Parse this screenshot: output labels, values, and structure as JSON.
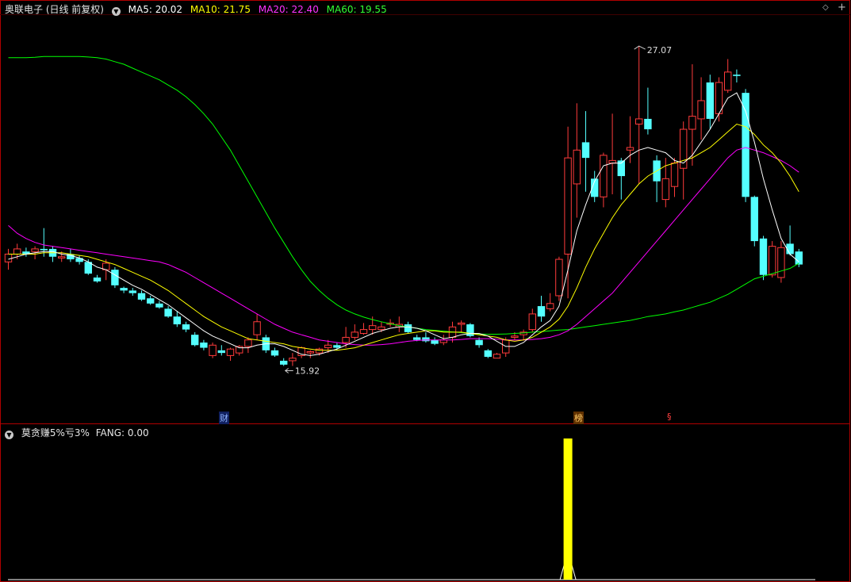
{
  "main": {
    "title": "奥联电子 (日线 前复权)",
    "ma5": "MA5: 20.02",
    "ma10": "MA10: 21.75",
    "ma20": "MA20: 22.40",
    "ma60": "MA60: 19.55",
    "high_label": "27.07",
    "low_label": "15.92",
    "markers": [
      "财",
      "榜",
      "§"
    ]
  },
  "sub": {
    "title": "莫贪赚5%亏3%",
    "value": "FANG: 0.00"
  },
  "colors": {
    "up": "#ff3b3b",
    "down": "#54ffff",
    "ma5": "#ffffff",
    "ma10": "#ffff00",
    "ma20": "#ff00ff",
    "ma60": "#00ff00",
    "signal": "#ffff00",
    "frame": "#b00000"
  },
  "icons": {
    "collapse": "chevron-down-icon",
    "diamond": "diamond-icon",
    "plus": "plus-icon"
  },
  "chart_data": [
    {
      "type": "candlestick",
      "title": "奥联电子 (日线 前复权)",
      "ylim": [
        14.0,
        29.0
      ],
      "ohlc": [
        [
          19.6,
          20.1,
          19.3,
          19.9
        ],
        [
          19.9,
          20.3,
          19.7,
          20.1
        ],
        [
          20.0,
          20.15,
          19.8,
          19.9
        ],
        [
          20.0,
          20.2,
          19.7,
          20.1
        ],
        [
          20.1,
          20.9,
          19.8,
          20.05
        ],
        [
          20.1,
          20.2,
          19.6,
          19.8
        ],
        [
          19.75,
          20.0,
          19.6,
          19.8
        ],
        [
          19.9,
          20.1,
          19.6,
          19.7
        ],
        [
          19.75,
          19.85,
          19.5,
          19.6
        ],
        [
          19.6,
          19.7,
          19.1,
          19.15
        ],
        [
          19.0,
          19.1,
          18.8,
          18.85
        ],
        [
          19.3,
          19.7,
          18.9,
          19.55
        ],
        [
          19.3,
          19.4,
          18.6,
          18.7
        ],
        [
          18.6,
          18.65,
          18.4,
          18.5
        ],
        [
          18.5,
          18.6,
          18.3,
          18.4
        ],
        [
          18.4,
          18.5,
          18.1,
          18.15
        ],
        [
          18.2,
          18.3,
          17.95,
          18.0
        ],
        [
          18.0,
          18.1,
          17.8,
          17.85
        ],
        [
          17.8,
          17.9,
          17.45,
          17.5
        ],
        [
          17.5,
          17.7,
          17.1,
          17.2
        ],
        [
          17.2,
          17.3,
          16.9,
          17.0
        ],
        [
          16.8,
          16.9,
          16.35,
          16.4
        ],
        [
          16.5,
          16.6,
          16.2,
          16.3
        ],
        [
          16.0,
          16.5,
          15.9,
          16.4
        ],
        [
          16.2,
          16.4,
          16.0,
          16.1
        ],
        [
          16.0,
          16.3,
          15.8,
          16.25
        ],
        [
          16.1,
          16.4,
          16.0,
          16.35
        ],
        [
          16.35,
          16.7,
          16.1,
          16.6
        ],
        [
          16.8,
          17.6,
          16.6,
          17.3
        ],
        [
          16.7,
          16.8,
          16.1,
          16.2
        ],
        [
          16.2,
          16.3,
          15.95,
          16.0
        ],
        [
          15.8,
          15.9,
          15.6,
          15.65
        ],
        [
          15.8,
          16.1,
          15.6,
          15.9
        ],
        [
          16.0,
          16.35,
          15.9,
          16.3
        ],
        [
          16.1,
          16.2,
          15.9,
          16.15
        ],
        [
          16.1,
          16.3,
          16.0,
          16.25
        ],
        [
          16.3,
          16.6,
          16.1,
          16.4
        ],
        [
          16.4,
          16.5,
          16.2,
          16.3
        ],
        [
          16.5,
          17.1,
          16.3,
          16.7
        ],
        [
          16.7,
          17.2,
          16.6,
          16.9
        ],
        [
          16.85,
          17.25,
          16.8,
          17.0
        ],
        [
          17.0,
          17.5,
          16.8,
          17.15
        ],
        [
          17.0,
          17.3,
          16.9,
          17.1
        ],
        [
          17.2,
          17.4,
          17.1,
          17.25
        ],
        [
          17.1,
          17.5,
          16.9,
          17.2
        ],
        [
          17.2,
          17.3,
          16.85,
          16.9
        ],
        [
          16.7,
          16.8,
          16.55,
          16.6
        ],
        [
          16.7,
          16.9,
          16.5,
          16.55
        ],
        [
          16.6,
          16.7,
          16.4,
          16.45
        ],
        [
          16.5,
          16.8,
          16.4,
          16.6
        ],
        [
          16.7,
          17.3,
          16.5,
          17.1
        ],
        [
          17.2,
          17.35,
          16.9,
          17.25
        ],
        [
          17.2,
          17.25,
          16.7,
          16.75
        ],
        [
          16.6,
          16.7,
          16.3,
          16.4
        ],
        [
          16.2,
          16.25,
          15.9,
          15.95
        ],
        [
          15.9,
          16.1,
          15.9,
          16.05
        ],
        [
          16.1,
          16.7,
          15.95,
          16.6
        ],
        [
          16.7,
          16.9,
          16.6,
          16.75
        ],
        [
          16.8,
          17.0,
          16.6,
          16.9
        ],
        [
          17.0,
          17.8,
          16.9,
          17.6
        ],
        [
          17.9,
          18.3,
          17.3,
          17.5
        ],
        [
          17.8,
          18.4,
          17.7,
          18.0
        ],
        [
          18.3,
          19.8,
          18.1,
          19.7
        ],
        [
          19.9,
          24.8,
          18.2,
          23.6
        ],
        [
          22.6,
          25.7,
          21.3,
          23.9
        ],
        [
          24.2,
          25.4,
          22.3,
          23.6
        ],
        [
          22.8,
          23.1,
          21.9,
          22.1
        ],
        [
          22.1,
          23.8,
          21.7,
          23.7
        ],
        [
          23.4,
          25.3,
          22.2,
          23.5
        ],
        [
          23.5,
          23.6,
          22.0,
          22.9
        ],
        [
          23.9,
          25.2,
          23.4,
          24.0
        ],
        [
          24.9,
          27.9,
          22.6,
          25.1
        ],
        [
          25.1,
          26.3,
          24.5,
          24.7
        ],
        [
          23.5,
          23.7,
          21.9,
          22.7
        ],
        [
          22.0,
          23.6,
          21.7,
          22.8
        ],
        [
          22.5,
          23.6,
          22.1,
          23.4
        ],
        [
          23.2,
          25.0,
          22.0,
          24.7
        ],
        [
          24.7,
          27.2,
          23.3,
          25.2
        ],
        [
          25.1,
          26.7,
          24.3,
          25.8
        ],
        [
          26.5,
          26.8,
          24.7,
          25.1
        ],
        [
          25.3,
          26.7,
          25.0,
          26.5
        ],
        [
          26.2,
          27.4,
          26.1,
          26.9
        ],
        [
          26.8,
          27.0,
          26.5,
          26.75
        ],
        [
          26.1,
          26.25,
          21.9,
          22.1
        ],
        [
          22.1,
          22.15,
          20.2,
          20.4
        ],
        [
          20.5,
          20.6,
          18.9,
          19.1
        ],
        [
          19.1,
          20.4,
          19.0,
          20.2
        ],
        [
          19.0,
          20.4,
          18.8,
          20.15
        ],
        [
          20.3,
          21.0,
          19.85,
          19.9
        ],
        [
          20.0,
          20.1,
          19.4,
          19.5
        ]
      ],
      "ma5": [
        19.7,
        19.8,
        19.9,
        19.95,
        20.0,
        20.0,
        19.9,
        19.85,
        19.75,
        19.6,
        19.4,
        19.3,
        19.1,
        18.9,
        18.7,
        18.55,
        18.35,
        18.15,
        17.95,
        17.7,
        17.45,
        17.2,
        16.95,
        16.75,
        16.6,
        16.45,
        16.3,
        16.3,
        16.4,
        16.45,
        16.45,
        16.35,
        16.2,
        16.05,
        16.0,
        16.05,
        16.15,
        16.25,
        16.4,
        16.55,
        16.7,
        16.85,
        16.95,
        17.05,
        17.1,
        17.1,
        17.05,
        16.95,
        16.8,
        16.65,
        16.7,
        16.8,
        16.85,
        16.85,
        16.75,
        16.55,
        16.35,
        16.35,
        16.5,
        16.8,
        17.1,
        17.35,
        17.9,
        19.3,
        20.8,
        21.8,
        22.7,
        23.3,
        23.4,
        23.4,
        23.7,
        23.9,
        24.0,
        23.9,
        23.8,
        23.5,
        23.4,
        23.7,
        24.2,
        24.7,
        25.3,
        25.9,
        26.1,
        25.4,
        24.2,
        22.8,
        21.6,
        20.5,
        19.9,
        19.6
      ],
      "ma10": [
        19.9,
        19.9,
        19.9,
        19.9,
        19.95,
        19.95,
        19.95,
        19.9,
        19.85,
        19.8,
        19.7,
        19.6,
        19.5,
        19.35,
        19.2,
        19.05,
        18.9,
        18.7,
        18.5,
        18.25,
        18.0,
        17.75,
        17.5,
        17.3,
        17.1,
        16.95,
        16.8,
        16.65,
        16.6,
        16.55,
        16.5,
        16.45,
        16.35,
        16.3,
        16.25,
        16.2,
        16.2,
        16.2,
        16.25,
        16.3,
        16.4,
        16.5,
        16.6,
        16.7,
        16.8,
        16.85,
        16.9,
        16.95,
        16.95,
        16.9,
        16.9,
        16.9,
        16.85,
        16.8,
        16.75,
        16.7,
        16.6,
        16.55,
        16.6,
        16.7,
        16.9,
        17.1,
        17.4,
        17.9,
        18.6,
        19.4,
        20.1,
        20.7,
        21.3,
        21.8,
        22.2,
        22.6,
        22.9,
        23.1,
        23.3,
        23.4,
        23.5,
        23.6,
        23.8,
        24.0,
        24.3,
        24.6,
        24.9,
        24.8,
        24.5,
        24.1,
        23.8,
        23.4,
        22.9,
        22.3
      ],
      "ma20": [
        21.0,
        20.7,
        20.5,
        20.35,
        20.25,
        20.2,
        20.15,
        20.1,
        20.05,
        20.0,
        19.95,
        19.9,
        19.85,
        19.8,
        19.75,
        19.7,
        19.65,
        19.6,
        19.5,
        19.35,
        19.2,
        19.0,
        18.8,
        18.6,
        18.4,
        18.2,
        18.0,
        17.8,
        17.6,
        17.4,
        17.2,
        17.05,
        16.9,
        16.8,
        16.7,
        16.6,
        16.55,
        16.5,
        16.45,
        16.42,
        16.4,
        16.4,
        16.42,
        16.45,
        16.5,
        16.55,
        16.58,
        16.6,
        16.6,
        16.6,
        16.6,
        16.62,
        16.65,
        16.65,
        16.65,
        16.63,
        16.6,
        16.6,
        16.6,
        16.62,
        16.65,
        16.7,
        16.8,
        16.95,
        17.2,
        17.5,
        17.8,
        18.1,
        18.4,
        18.8,
        19.2,
        19.6,
        20.0,
        20.4,
        20.8,
        21.2,
        21.6,
        22.0,
        22.4,
        22.8,
        23.2,
        23.6,
        23.9,
        24.0,
        23.9,
        23.8,
        23.65,
        23.5,
        23.3,
        23.05
      ],
      "ma60": [
        27.45,
        27.45,
        27.45,
        27.47,
        27.5,
        27.5,
        27.5,
        27.5,
        27.5,
        27.48,
        27.45,
        27.4,
        27.3,
        27.2,
        27.05,
        26.9,
        26.75,
        26.6,
        26.4,
        26.2,
        25.95,
        25.65,
        25.3,
        24.9,
        24.4,
        23.9,
        23.3,
        22.7,
        22.1,
        21.5,
        20.9,
        20.35,
        19.8,
        19.3,
        18.85,
        18.5,
        18.2,
        17.95,
        17.75,
        17.6,
        17.48,
        17.38,
        17.3,
        17.22,
        17.15,
        17.1,
        17.05,
        17.0,
        16.97,
        16.94,
        16.91,
        16.88,
        16.85,
        16.83,
        16.82,
        16.82,
        16.83,
        16.85,
        16.87,
        16.9,
        16.92,
        16.95,
        16.98,
        17.0,
        17.05,
        17.1,
        17.15,
        17.2,
        17.25,
        17.3,
        17.35,
        17.42,
        17.5,
        17.55,
        17.6,
        17.68,
        17.75,
        17.85,
        17.95,
        18.05,
        18.2,
        18.35,
        18.55,
        18.75,
        18.95,
        19.05,
        19.15,
        19.25,
        19.35,
        19.55
      ],
      "high": 27.07,
      "low": 15.92
    },
    {
      "type": "bar",
      "title": "莫贪赚5%亏3%",
      "series": [
        {
          "name": "FANG",
          "signal_index": 63,
          "value": 1
        }
      ]
    }
  ]
}
